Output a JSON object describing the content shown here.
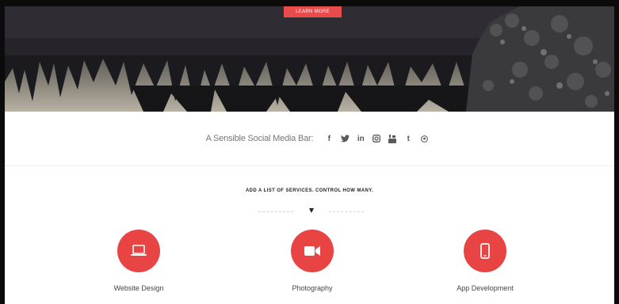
{
  "hero": {
    "cta_label": "Learn More"
  },
  "social": {
    "label": "A Sensible Social Media Bar:",
    "icons": [
      {
        "name": "facebook-icon",
        "glyph": "f"
      },
      {
        "name": "twitter-icon",
        "glyph": "🐦"
      },
      {
        "name": "linkedin-icon",
        "glyph": "in"
      },
      {
        "name": "instagram-icon",
        "glyph": "◙"
      },
      {
        "name": "youtube-icon",
        "glyph": "▣"
      },
      {
        "name": "tumblr-icon",
        "glyph": "t"
      },
      {
        "name": "pinterest-icon",
        "glyph": "℗"
      }
    ]
  },
  "services": {
    "title": "ADD A LIST OF SERVICES. CONTROL HOW MANY.",
    "items": [
      {
        "label": "Website Design",
        "icon": "laptop-icon"
      },
      {
        "label": "Photography",
        "icon": "video-camera-icon"
      },
      {
        "label": "App Development",
        "icon": "mobile-phone-icon"
      }
    ]
  },
  "colors": {
    "accent": "#e74443",
    "text_muted": "#777777"
  }
}
